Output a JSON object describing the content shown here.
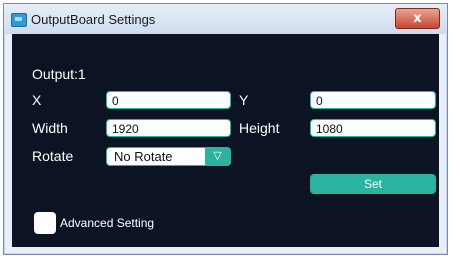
{
  "window": {
    "title": "OutputBoard Settings",
    "close_glyph": "x"
  },
  "output": {
    "label": "Output:1"
  },
  "fields": {
    "x": {
      "label": "X",
      "value": "0"
    },
    "y": {
      "label": "Y",
      "value": "0"
    },
    "width": {
      "label": "Width",
      "value": "1920"
    },
    "height": {
      "label": "Height",
      "value": "1080"
    }
  },
  "rotate": {
    "label": "Rotate",
    "selected": "No Rotate",
    "arrow": "▽"
  },
  "set_button": {
    "label": "Set"
  },
  "advanced": {
    "label": "Advanced Setting",
    "checked": false
  },
  "colors": {
    "accent": "#2ab39f",
    "background": "#0c1424"
  },
  "icons": [
    "app-icon",
    "close-icon",
    "dropdown-arrow-icon"
  ]
}
